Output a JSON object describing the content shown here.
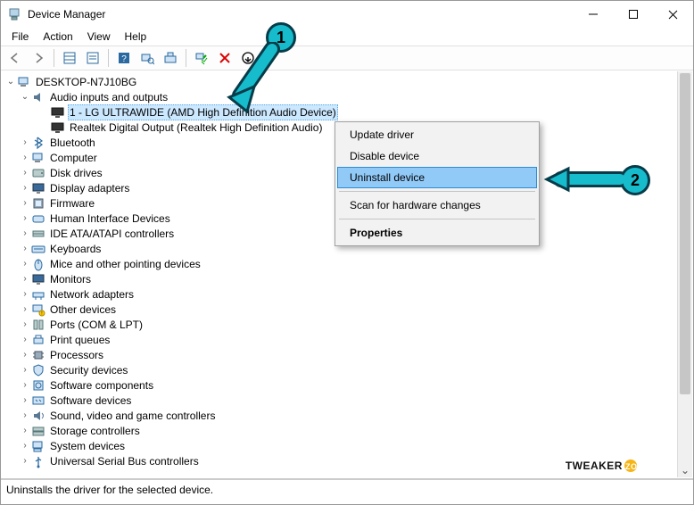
{
  "window": {
    "title": "Device Manager",
    "menus": [
      "File",
      "Action",
      "View",
      "Help"
    ]
  },
  "tree": {
    "root": "DESKTOP-N7J10BG",
    "audio_category": "Audio inputs and outputs",
    "audio_device_1": "1 - LG ULTRAWIDE (AMD High Definition Audio Device)",
    "audio_device_2": "Realtek Digital Output (Realtek High Definition Audio)",
    "categories": [
      "Bluetooth",
      "Computer",
      "Disk drives",
      "Display adapters",
      "Firmware",
      "Human Interface Devices",
      "IDE ATA/ATAPI controllers",
      "Keyboards",
      "Mice and other pointing devices",
      "Monitors",
      "Network adapters",
      "Other devices",
      "Ports (COM & LPT)",
      "Print queues",
      "Processors",
      "Security devices",
      "Software components",
      "Software devices",
      "Sound, video and game controllers",
      "Storage controllers",
      "System devices",
      "Universal Serial Bus controllers"
    ]
  },
  "context_menu": {
    "update": "Update driver",
    "disable": "Disable device",
    "uninstall": "Uninstall device",
    "scan": "Scan for hardware changes",
    "properties": "Properties"
  },
  "status": "Uninstalls the driver for the selected device.",
  "callouts": {
    "one": "1",
    "two": "2"
  },
  "watermark": {
    "brand": "TWEAKER",
    "sub": "ZONE"
  }
}
